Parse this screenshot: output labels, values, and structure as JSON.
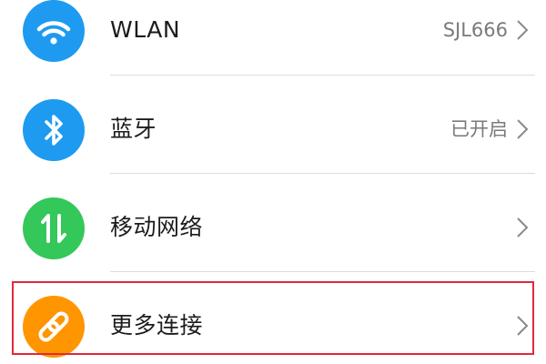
{
  "items": [
    {
      "label": "WLAN",
      "value": "SJL666",
      "icon": "wifi-icon",
      "color": "#1e9bf0"
    },
    {
      "label": "蓝牙",
      "value": "已开启",
      "icon": "bluetooth-icon",
      "color": "#1e9bf0"
    },
    {
      "label": "移动网络",
      "value": "",
      "icon": "mobile-data-icon",
      "color": "#34c759"
    },
    {
      "label": "更多连接",
      "value": "",
      "icon": "link-icon",
      "color": "#ff9500"
    }
  ],
  "highlight_color": "#e02a3c"
}
